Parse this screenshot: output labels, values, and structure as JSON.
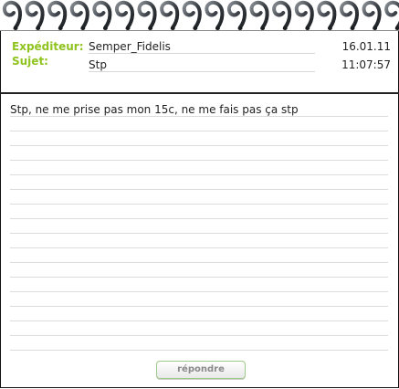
{
  "header": {
    "sender_label": "Expéditeur:",
    "sender": "Semper_Fidelis",
    "subject_label": "Sujet:",
    "subject": "Stp",
    "date": "16.01.11",
    "time": "11:07:57"
  },
  "message": {
    "body": "Stp, ne me prise pas mon 15c, ne me fais pas ça stp"
  },
  "actions": {
    "reply_label": "répondre"
  },
  "colors": {
    "label_green": "#8fc31f",
    "spiral_dark": "#3a3f45",
    "button_border": "#9fc98a"
  }
}
